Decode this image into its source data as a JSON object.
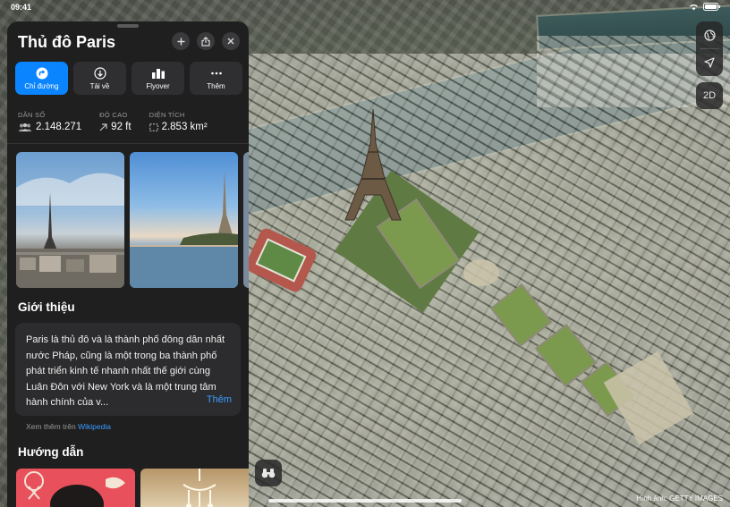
{
  "status": {
    "time": "09:41"
  },
  "panel": {
    "title": "Thủ đô Paris",
    "actions": [
      {
        "label": "Chỉ đường",
        "icon": "directions-icon"
      },
      {
        "label": "Tải về",
        "icon": "download-icon"
      },
      {
        "label": "Flyover",
        "icon": "flyover-icon"
      },
      {
        "label": "Thêm",
        "icon": "more-icon"
      }
    ],
    "stats": [
      {
        "caption": "DÂN SỐ",
        "value": "2.148.271",
        "icon": "people-icon"
      },
      {
        "caption": "ĐỘ CAO",
        "value": "92 ft",
        "icon": "elevation-arrow-icon"
      },
      {
        "caption": "DIỆN TÍCH",
        "value": "2.853 km²",
        "icon": "area-icon"
      }
    ],
    "about": {
      "heading": "Giới thiệu",
      "text": "Paris là thủ đô và là thành phố đông dân nhất nước Pháp, cũng là một trong ba thành phố phát triển kinh tế nhanh nhất thế giới cùng Luân Đôn với New York và là một trung tâm hành chính của v...",
      "more": "Thêm",
      "source_prefix": "Xem thêm trên",
      "source_link": "Wikipedia"
    },
    "guides_heading": "Hướng dẫn"
  },
  "map": {
    "view_mode": "2D",
    "credit": "Hình ảnh: GETTY IMAGES",
    "controls": [
      "globe-icon",
      "location-arrow-icon"
    ]
  },
  "colors": {
    "accent": "#0a84ff",
    "panel_bg": "#1f1f1f",
    "card_bg": "#2c2c2e"
  }
}
